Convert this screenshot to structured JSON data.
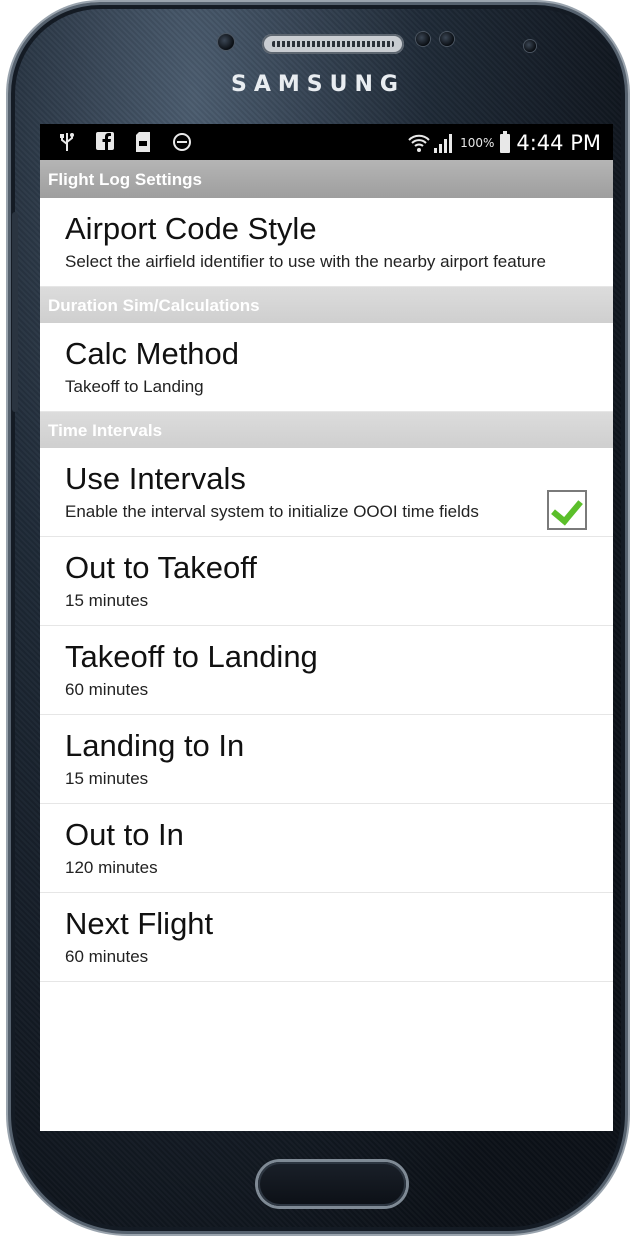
{
  "device": {
    "brand": "SAMSUNG"
  },
  "status_bar": {
    "icons_left": [
      "usb-icon",
      "facebook-icon",
      "sd-card-icon",
      "do-not-disturb-icon"
    ],
    "battery_percent": "100%",
    "time": "4:44 PM"
  },
  "settings": {
    "sections": [
      {
        "header": "Flight Log Settings",
        "items": [
          {
            "title": "Airport Code Style",
            "summary": "Select the airfield identifier to use with the nearby airport feature"
          }
        ]
      },
      {
        "header": "Duration Sim/Calculations",
        "items": [
          {
            "title": "Calc Method",
            "summary": "Takeoff to Landing"
          }
        ]
      },
      {
        "header": "Time Intervals",
        "items": [
          {
            "title": "Use Intervals",
            "summary": "Enable the interval system to initialize OOOI time fields",
            "checked": true
          },
          {
            "title": "Out to Takeoff",
            "summary": "15 minutes"
          },
          {
            "title": "Takeoff to Landing",
            "summary": "60 minutes"
          },
          {
            "title": "Landing to In",
            "summary": "15 minutes"
          },
          {
            "title": "Out to In",
            "summary": "120 minutes"
          },
          {
            "title": "Next Flight",
            "summary": "60 minutes"
          }
        ]
      }
    ]
  },
  "colors": {
    "header_dark": "#a6a6a6",
    "header_light": "#d5d5d5",
    "checkbox_tick": "#5bbf2a"
  }
}
